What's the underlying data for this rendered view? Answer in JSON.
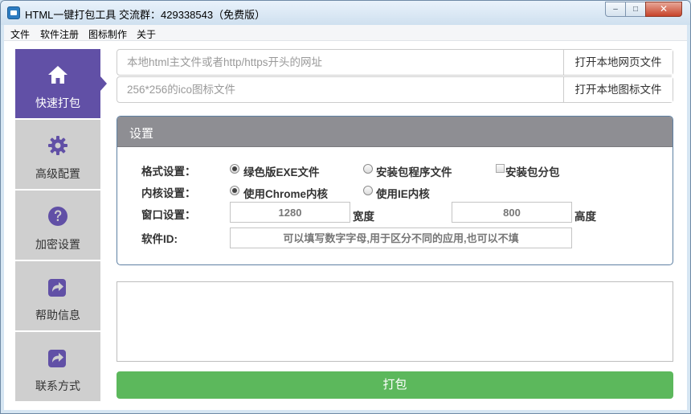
{
  "window": {
    "title": "HTML一键打包工具 交流群：429338543（免费版）",
    "minimize_label": "–",
    "maximize_label": "□",
    "close_label": "✕"
  },
  "menu": [
    "文件",
    "软件注册",
    "图标制作",
    "关于"
  ],
  "sidebar": {
    "items": [
      {
        "label": "快速打包",
        "icon": "home-icon",
        "active": true
      },
      {
        "label": "高级配置",
        "icon": "gear-icon",
        "active": false
      },
      {
        "label": "加密设置",
        "icon": "question-icon",
        "active": false
      },
      {
        "label": "帮助信息",
        "icon": "share-icon",
        "active": false
      },
      {
        "label": "联系方式",
        "icon": "share-icon",
        "active": false
      }
    ],
    "active_color": "#6150a6",
    "inactive_color": "#cfcfcf"
  },
  "source": {
    "url_placeholder": "本地html主文件或者http/https开头的网址",
    "url_value": "",
    "open_page_label": "打开本地网页文件",
    "ico_placeholder": "256*256的ico图标文件",
    "ico_value": "",
    "open_icon_label": "打开本地图标文件"
  },
  "settings": {
    "title": "设置",
    "format": {
      "label": "格式设置：",
      "options": [
        "绿色版EXE文件",
        "安装包程序文件"
      ],
      "selected": "绿色版EXE文件",
      "split_label": "安装包分包",
      "split_checked": false
    },
    "kernel": {
      "label": "内核设置：",
      "options": [
        "使用Chrome内核",
        "使用IE内核"
      ],
      "selected": "使用Chrome内核"
    },
    "window": {
      "label": "窗口设置：",
      "width_placeholder": "1280",
      "width_unit": "宽度",
      "height_placeholder": "800",
      "height_unit": "高度"
    },
    "app_id": {
      "label": "软件ID:",
      "placeholder": "可以填写数字字母,用于区分不同的应用,也可以不填"
    }
  },
  "log": {
    "value": ""
  },
  "pack_button": {
    "label": "打包",
    "color": "#5cb85c"
  }
}
